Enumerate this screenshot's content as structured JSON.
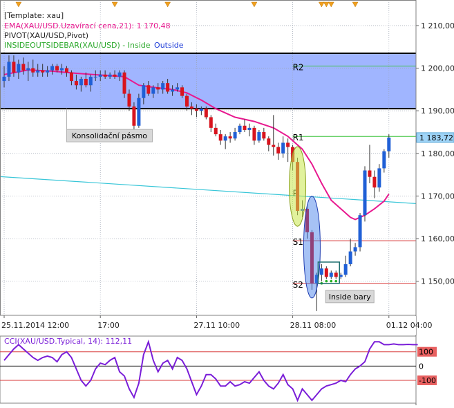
{
  "legend": {
    "template": "[Template: xau]",
    "ema": "EMA(XAU/USD.Uzavírací cena,21): 1 170,48",
    "pivot": "PIVOT(XAU/USD,Pivot)",
    "insideoutside_prefix": "INSIDEOUTSIDEBAR(XAU/USD) -",
    "inside_label": "Inside",
    "outside_label": "Outside"
  },
  "colors": {
    "bull": "#1f5fd6",
    "bear": "#d8141e",
    "ema": "#e8198f",
    "zone": "#8fa8ff",
    "trendline": "#38c6d8",
    "pivot_r": "#3cc43c",
    "pivot_s": "#d83838",
    "cci": "#7a1ed8"
  },
  "chart_data": [
    {
      "type": "candlestick",
      "symbol": "XAU/USD",
      "ylim": [
        1142,
        1216
      ],
      "yticks": [
        1150,
        1160,
        1170,
        1180,
        1190,
        1200,
        1210
      ],
      "ytick_labels": [
        "1 150,00",
        "1 160,00",
        "1 170,00",
        "1 180,00",
        "1 190,00",
        "1 200,00",
        "1 210,00"
      ],
      "last_price": 1183.72,
      "last_price_label": "1 183,72",
      "xtick_labels": [
        {
          "label": "25.11.2014 12:00",
          "bar": 0
        },
        {
          "label": "17:00",
          "bar": 20
        },
        {
          "label": "27.11 10:00",
          "bar": 40
        },
        {
          "label": "28.11 08:00",
          "bar": 60
        },
        {
          "label": "01.12 04:00",
          "bar": 80
        }
      ],
      "candles": [
        [
          1197.0,
          1200.5,
          1195.5,
          1198.0
        ],
        [
          1198.0,
          1203.0,
          1197.0,
          1201.5
        ],
        [
          1201.5,
          1203.0,
          1198.0,
          1199.0
        ],
        [
          1199.0,
          1202.0,
          1197.5,
          1201.0
        ],
        [
          1201.0,
          1202.5,
          1198.5,
          1199.5
        ],
        [
          1199.5,
          1201.5,
          1197.0,
          1200.0
        ],
        [
          1200.0,
          1202.0,
          1198.0,
          1199.0
        ],
        [
          1199.0,
          1201.0,
          1198.0,
          1199.5
        ],
        [
          1199.5,
          1201.0,
          1198.0,
          1199.0
        ],
        [
          1199.0,
          1200.5,
          1198.0,
          1199.5
        ],
        [
          1199.5,
          1201.0,
          1198.5,
          1200.5
        ],
        [
          1200.5,
          1201.0,
          1199.0,
          1199.5
        ],
        [
          1199.5,
          1201.0,
          1198.5,
          1200.0
        ],
        [
          1200.0,
          1200.5,
          1198.0,
          1199.0
        ],
        [
          1199.0,
          1199.5,
          1196.0,
          1197.0
        ],
        [
          1197.0,
          1198.5,
          1195.0,
          1196.0
        ],
        [
          1196.0,
          1198.0,
          1194.5,
          1197.5
        ],
        [
          1197.5,
          1199.0,
          1195.5,
          1196.0
        ],
        [
          1196.0,
          1198.5,
          1194.5,
          1198.0
        ],
        [
          1198.0,
          1199.5,
          1197.0,
          1198.0
        ],
        [
          1198.0,
          1199.5,
          1197.0,
          1198.5
        ],
        [
          1198.5,
          1199.5,
          1197.5,
          1198.0
        ],
        [
          1198.0,
          1199.0,
          1197.5,
          1198.5
        ],
        [
          1198.5,
          1199.5,
          1197.5,
          1198.0
        ],
        [
          1198.0,
          1199.5,
          1197.0,
          1199.0
        ],
        [
          1199.0,
          1199.5,
          1193.0,
          1194.0
        ],
        [
          1194.0,
          1195.0,
          1190.0,
          1191.0
        ],
        [
          1191.0,
          1192.0,
          1185.0,
          1186.5
        ],
        [
          1186.5,
          1194.0,
          1186.0,
          1193.0
        ],
        [
          1193.0,
          1196.5,
          1191.5,
          1196.0
        ],
        [
          1196.0,
          1197.0,
          1193.5,
          1194.0
        ],
        [
          1194.0,
          1196.0,
          1193.0,
          1195.5
        ],
        [
          1195.5,
          1196.5,
          1194.0,
          1195.0
        ],
        [
          1195.0,
          1197.0,
          1194.0,
          1196.5
        ],
        [
          1196.5,
          1197.5,
          1194.0,
          1194.5
        ],
        [
          1194.5,
          1196.0,
          1193.5,
          1195.0
        ],
        [
          1195.0,
          1196.5,
          1194.5,
          1195.5
        ],
        [
          1195.5,
          1196.0,
          1193.0,
          1193.5
        ],
        [
          1193.5,
          1194.0,
          1190.0,
          1191.0
        ],
        [
          1191.0,
          1192.0,
          1189.0,
          1190.5
        ],
        [
          1190.5,
          1191.5,
          1188.5,
          1190.0
        ],
        [
          1190.0,
          1191.0,
          1189.0,
          1190.5
        ],
        [
          1190.5,
          1191.0,
          1188.0,
          1188.5
        ],
        [
          1188.5,
          1189.0,
          1185.0,
          1186.0
        ],
        [
          1186.0,
          1187.0,
          1184.0,
          1184.5
        ],
        [
          1184.5,
          1185.5,
          1182.0,
          1183.0
        ],
        [
          1183.0,
          1184.5,
          1181.0,
          1184.0
        ],
        [
          1184.0,
          1185.0,
          1182.5,
          1183.5
        ],
        [
          1183.5,
          1186.0,
          1183.0,
          1185.0
        ],
        [
          1185.0,
          1187.0,
          1184.5,
          1186.5
        ],
        [
          1186.5,
          1188.0,
          1185.0,
          1185.5
        ],
        [
          1185.5,
          1187.0,
          1184.0,
          1186.0
        ],
        [
          1186.0,
          1186.5,
          1182.0,
          1183.0
        ],
        [
          1183.0,
          1185.5,
          1182.5,
          1185.0
        ],
        [
          1185.0,
          1186.0,
          1183.0,
          1183.5
        ],
        [
          1183.5,
          1184.0,
          1180.5,
          1182.0
        ],
        [
          1182.0,
          1189.0,
          1179.5,
          1181.5
        ],
        [
          1181.5,
          1182.5,
          1178.5,
          1180.0
        ],
        [
          1180.0,
          1184.0,
          1179.0,
          1182.5
        ],
        [
          1182.5,
          1183.5,
          1178.0,
          1181.5
        ],
        [
          1181.5,
          1182.0,
          1176.0,
          1178.0
        ],
        [
          1178.0,
          1179.0,
          1165.5,
          1166.5
        ],
        [
          1166.5,
          1169.0,
          1165.0,
          1167.0
        ],
        [
          1167.0,
          1168.0,
          1160.0,
          1161.5
        ],
        [
          1161.5,
          1162.0,
          1148.0,
          1149.5
        ],
        [
          1149.5,
          1152.0,
          1143.0,
          1151.5
        ],
        [
          1151.5,
          1154.0,
          1150.0,
          1153.0
        ],
        [
          1153.0,
          1153.5,
          1150.5,
          1151.0
        ],
        [
          1151.0,
          1152.5,
          1150.5,
          1152.0
        ],
        [
          1152.0,
          1152.5,
          1150.5,
          1151.0
        ],
        [
          1151.0,
          1152.0,
          1150.5,
          1151.5
        ],
        [
          1151.5,
          1156.0,
          1151.0,
          1154.0
        ],
        [
          1154.0,
          1160.0,
          1153.5,
          1157.0
        ],
        [
          1157.0,
          1159.0,
          1156.0,
          1158.0
        ],
        [
          1158.0,
          1166.0,
          1157.0,
          1165.5
        ],
        [
          1165.5,
          1177.0,
          1164.0,
          1176.0
        ],
        [
          1176.0,
          1182.0,
          1173.0,
          1174.5
        ],
        [
          1174.5,
          1176.0,
          1169.5,
          1172.0
        ],
        [
          1172.0,
          1177.5,
          1171.0,
          1176.5
        ],
        [
          1176.5,
          1181.0,
          1175.5,
          1180.5
        ],
        [
          1180.5,
          1184.5,
          1179.0,
          1183.72
        ]
      ],
      "ema": {
        "name": "EMA(XAU/USD.Uzavírací cena,21)",
        "points": [
          [
            0,
            1198.5
          ],
          [
            5,
            1199.6
          ],
          [
            10,
            1199.3
          ],
          [
            15,
            1198.8
          ],
          [
            20,
            1198.4
          ],
          [
            25,
            1198.0
          ],
          [
            28,
            1196.0
          ],
          [
            31,
            1195.5
          ],
          [
            35,
            1195.0
          ],
          [
            38,
            1194.2
          ],
          [
            41,
            1192.5
          ],
          [
            44,
            1190.5
          ],
          [
            48,
            1188.5
          ],
          [
            52,
            1187.5
          ],
          [
            56,
            1186.0
          ],
          [
            59,
            1184.0
          ],
          [
            62,
            1181.0
          ],
          [
            64,
            1177.5
          ],
          [
            66,
            1173.0
          ],
          [
            68,
            1169.0
          ],
          [
            70,
            1167.0
          ],
          [
            72,
            1165.0
          ],
          [
            73,
            1164.5
          ],
          [
            75,
            1165.5
          ],
          [
            77,
            1167.0
          ],
          [
            79,
            1168.8
          ],
          [
            80,
            1170.48
          ]
        ]
      },
      "consolidation_zone": {
        "top": 1203.5,
        "bottom": 1190.5,
        "label": "Konsolidační pásmo"
      },
      "trendline": {
        "from": [
          0,
          1174.5
        ],
        "to": [
          82,
          1168.5
        ]
      },
      "pivots": [
        {
          "name": "R2",
          "value": 1200.5,
          "from_bar": 60
        },
        {
          "name": "R1",
          "value": 1184.0,
          "from_bar": 60
        },
        {
          "name": "P",
          "value": 1171.0,
          "from_bar": 60
        },
        {
          "name": "S1",
          "value": 1159.5,
          "from_bar": 60
        },
        {
          "name": "S2",
          "value": 1149.5,
          "from_bar": 60
        }
      ],
      "inside_bars_label": "Inside bary",
      "outside_bars": [
        61,
        64
      ],
      "inside_bars": [
        66,
        67,
        68,
        69
      ]
    },
    {
      "type": "line",
      "name": "CCI(XAU/USD.Typical, 14)",
      "title": "CCI(XAU/USD.Typical, 14): 112,11",
      "ylim": [
        -260,
        210
      ],
      "levels": [
        100,
        0,
        -100
      ],
      "level_labels": [
        "100",
        "0",
        "-100"
      ],
      "values": [
        40,
        80,
        120,
        150,
        120,
        90,
        60,
        40,
        60,
        70,
        60,
        30,
        80,
        100,
        60,
        -20,
        -100,
        -140,
        -100,
        -20,
        20,
        10,
        40,
        60,
        -40,
        -70,
        -160,
        -220,
        -120,
        80,
        170,
        40,
        -40,
        20,
        40,
        -20,
        60,
        40,
        -20,
        -110,
        -200,
        -140,
        -60,
        -60,
        -90,
        -140,
        -140,
        -110,
        -140,
        -130,
        -110,
        -120,
        -80,
        -40,
        -100,
        -140,
        -160,
        -120,
        -60,
        -130,
        -160,
        -240,
        -160,
        -200,
        -240,
        -200,
        -160,
        -140,
        -130,
        -120,
        -100,
        -110,
        -60,
        -20,
        0,
        30,
        120,
        170,
        170,
        150,
        150,
        155,
        150,
        150,
        152,
        150,
        150
      ]
    }
  ]
}
